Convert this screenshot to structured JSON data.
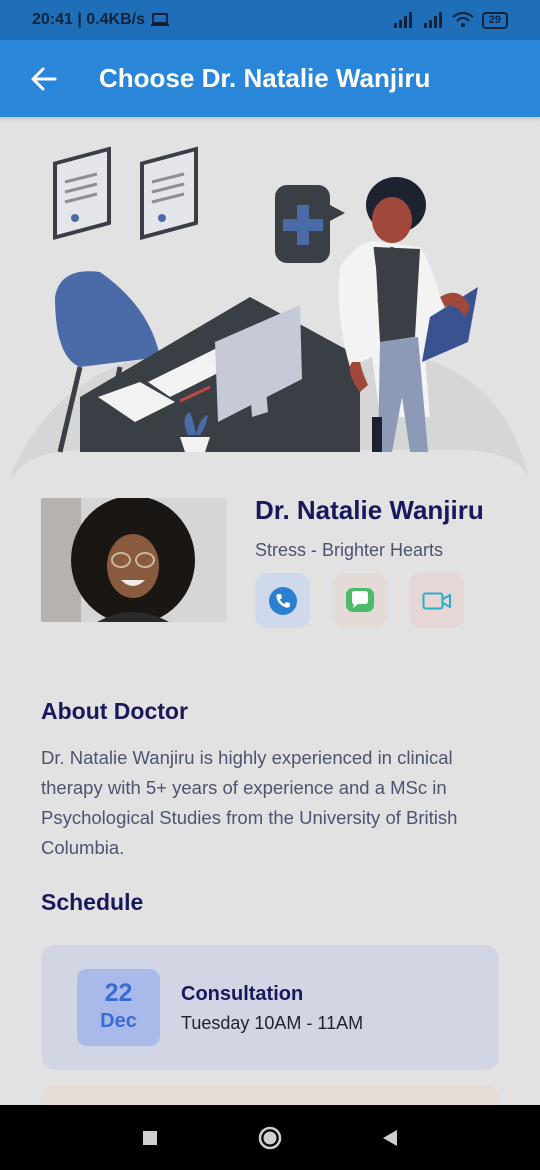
{
  "status": {
    "time_speed": "20:41 | 0.4KB/s",
    "battery": "29"
  },
  "appbar": {
    "title": "Choose Dr. Natalie Wanjiru"
  },
  "doctor": {
    "name": "Dr. Natalie Wanjiru",
    "specialty": "Stress - Brighter Hearts"
  },
  "about": {
    "heading": "About Doctor",
    "text": "Dr. Natalie Wanjiru is highly experienced in clinical therapy with 5+ years of experience and a MSc in Psychological Studies from the University of British Columbia."
  },
  "schedule": {
    "heading": "Schedule",
    "items": [
      {
        "day": "22",
        "month": "Dec",
        "title": "Consultation",
        "time": "Tuesday 10AM - 11AM"
      }
    ]
  },
  "colors": {
    "appbar": "#2a86d8",
    "heading": "#18195a",
    "call_bg": "#d0d9ec",
    "message_bg": "#e3dcd6",
    "video_bg": "#e6d6d6"
  },
  "icons": {
    "back": "arrow-left-icon",
    "call": "phone-icon",
    "message": "chat-icon",
    "video": "video-camera-icon"
  }
}
